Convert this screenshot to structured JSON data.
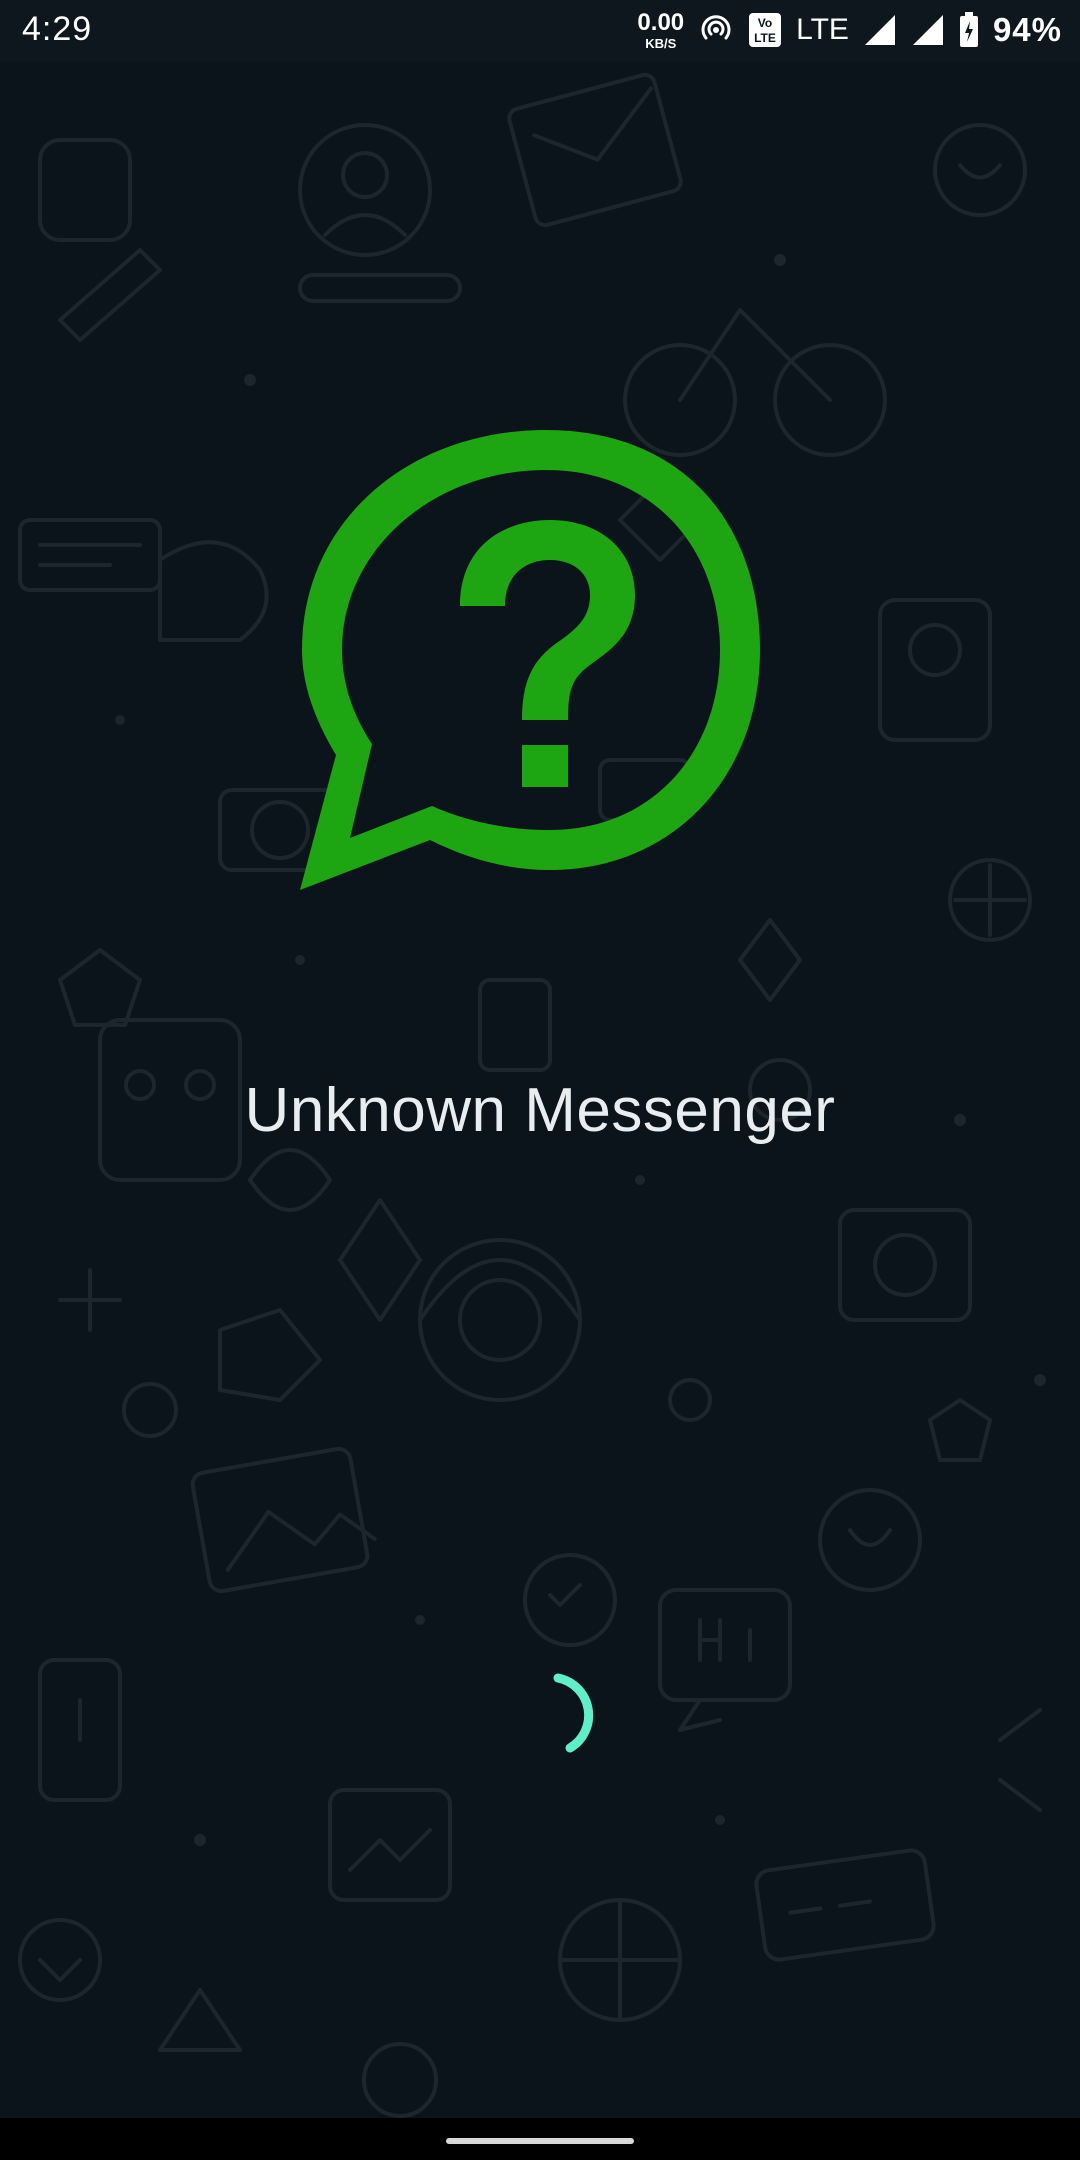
{
  "status_bar": {
    "time": "4:29",
    "net_speed_value": "0.00",
    "net_speed_unit": "KB/S",
    "volte_icon": "volte-icon",
    "network_type": "LTE",
    "battery_percent": "94%"
  },
  "splash": {
    "logo_icon": "question-chat-bubble-icon",
    "app_name": "Unknown Messenger",
    "loading_indicator": "spinner-icon"
  },
  "colors": {
    "background": "#0b141a",
    "logo_green": "#1da512",
    "spinner_accent": "#5ef0c9",
    "title_text": "#e9edef"
  }
}
